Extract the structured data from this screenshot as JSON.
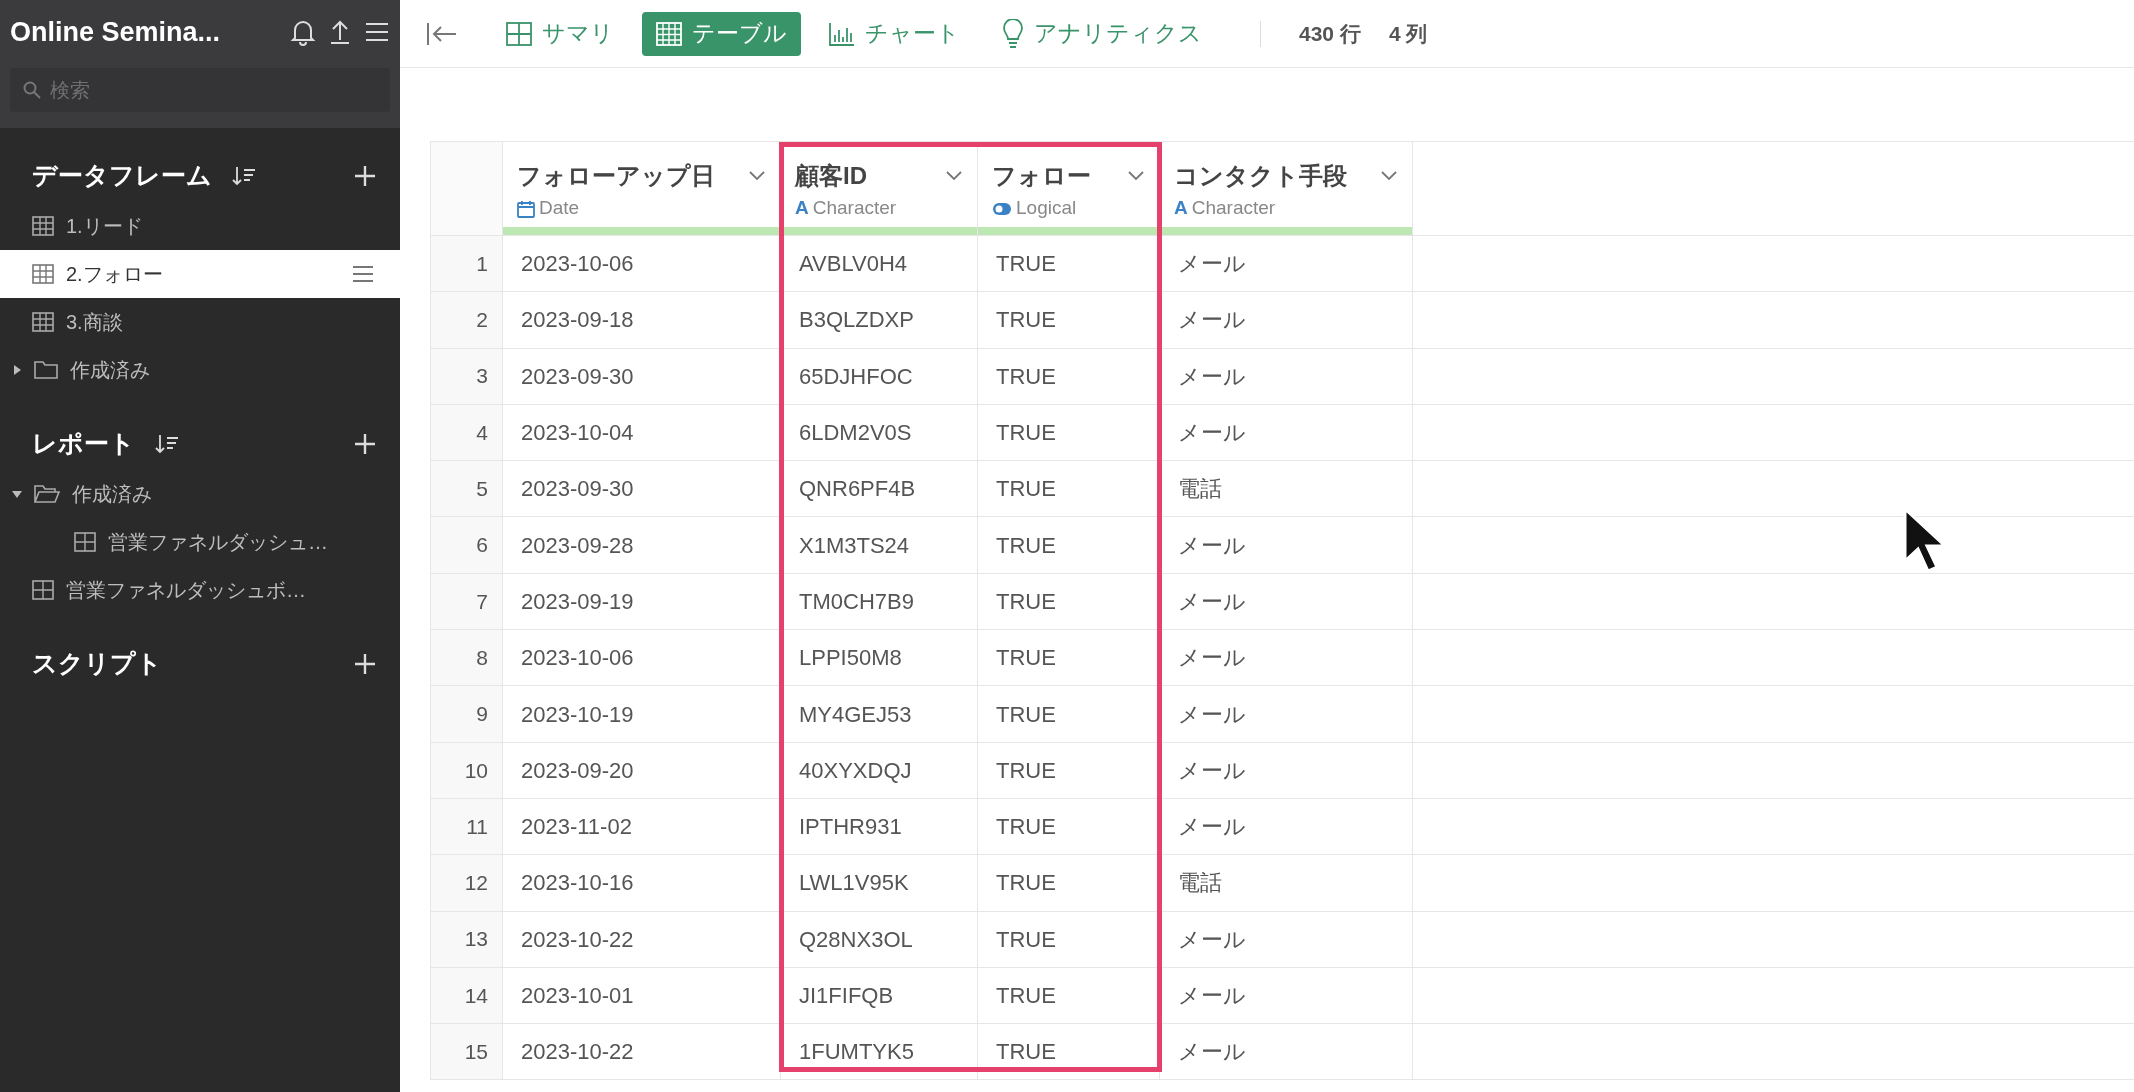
{
  "sidebar": {
    "project_title": "Online Semina...",
    "search": {
      "placeholder": "検索"
    },
    "sections": [
      {
        "title": "データフレーム",
        "sortable": true,
        "items": [
          {
            "kind": "dataframe",
            "label": "1.リード",
            "selected": false
          },
          {
            "kind": "dataframe",
            "label": "2.フォロー",
            "selected": true
          },
          {
            "kind": "dataframe",
            "label": "3.商談",
            "selected": false
          },
          {
            "kind": "folder",
            "label": "作成済み",
            "expanded": false,
            "selected": false
          }
        ]
      },
      {
        "title": "レポート",
        "sortable": true,
        "items": [
          {
            "kind": "folder",
            "label": "作成済み",
            "expanded": true,
            "selected": false,
            "children": [
              {
                "kind": "report",
                "label": "営業ファネルダッシュ…",
                "selected": false
              }
            ]
          },
          {
            "kind": "report",
            "label": "営業ファネルダッシュボ…",
            "selected": false
          }
        ]
      },
      {
        "title": "スクリプト",
        "sortable": false
      }
    ]
  },
  "toolbar": {
    "tabs": [
      {
        "kind": "summary",
        "label": "サマリ",
        "selected": false
      },
      {
        "kind": "table",
        "label": "テーブル",
        "selected": true
      },
      {
        "kind": "chart",
        "label": "チャート",
        "selected": false
      },
      {
        "kind": "analytics",
        "label": "アナリティクス",
        "selected": false
      }
    ],
    "stats": [
      "430 行",
      "4 列"
    ]
  },
  "table": {
    "columns": [
      {
        "name": "フォローアップ日",
        "kind": "date",
        "type_label": "Date",
        "highlighted": false
      },
      {
        "name": "顧客ID",
        "kind": "character",
        "type_glyph": "A",
        "type_label": "Character",
        "highlighted": true
      },
      {
        "name": "フォロー",
        "kind": "logical",
        "type_label": "Logical",
        "highlighted": true
      },
      {
        "name": "コンタクト手段",
        "kind": "character",
        "type_glyph": "A",
        "type_label": "Character",
        "highlighted": false
      }
    ],
    "rows": [
      {
        "number": "1",
        "cells": [
          "2023-10-06",
          "AVBLV0H4",
          "TRUE",
          "メール"
        ]
      },
      {
        "number": "2",
        "cells": [
          "2023-09-18",
          "B3QLZDXP",
          "TRUE",
          "メール"
        ]
      },
      {
        "number": "3",
        "cells": [
          "2023-09-30",
          "65DJHFOC",
          "TRUE",
          "メール"
        ]
      },
      {
        "number": "4",
        "cells": [
          "2023-10-04",
          "6LDM2V0S",
          "TRUE",
          "メール"
        ]
      },
      {
        "number": "5",
        "cells": [
          "2023-09-30",
          "QNR6PF4B",
          "TRUE",
          "電話"
        ]
      },
      {
        "number": "6",
        "cells": [
          "2023-09-28",
          "X1M3TS24",
          "TRUE",
          "メール"
        ]
      },
      {
        "number": "7",
        "cells": [
          "2023-09-19",
          "TM0CH7B9",
          "TRUE",
          "メール"
        ]
      },
      {
        "number": "8",
        "cells": [
          "2023-10-06",
          "LPPI50M8",
          "TRUE",
          "メール"
        ]
      },
      {
        "number": "9",
        "cells": [
          "2023-10-19",
          "MY4GEJ53",
          "TRUE",
          "メール"
        ]
      },
      {
        "number": "10",
        "cells": [
          "2023-09-20",
          "40XYXDQJ",
          "TRUE",
          "メール"
        ]
      },
      {
        "number": "11",
        "cells": [
          "2023-11-02",
          "IPTHR931",
          "TRUE",
          "メール"
        ]
      },
      {
        "number": "12",
        "cells": [
          "2023-10-16",
          "LWL1V95K",
          "TRUE",
          "電話"
        ]
      },
      {
        "number": "13",
        "cells": [
          "2023-10-22",
          "Q28NX3OL",
          "TRUE",
          "メール"
        ]
      },
      {
        "number": "14",
        "cells": [
          "2023-10-01",
          "JI1FIFQB",
          "TRUE",
          "メール"
        ]
      },
      {
        "number": "15",
        "cells": [
          "2023-10-22",
          "1FUMTYK5",
          "TRUE",
          "メール"
        ]
      }
    ]
  }
}
